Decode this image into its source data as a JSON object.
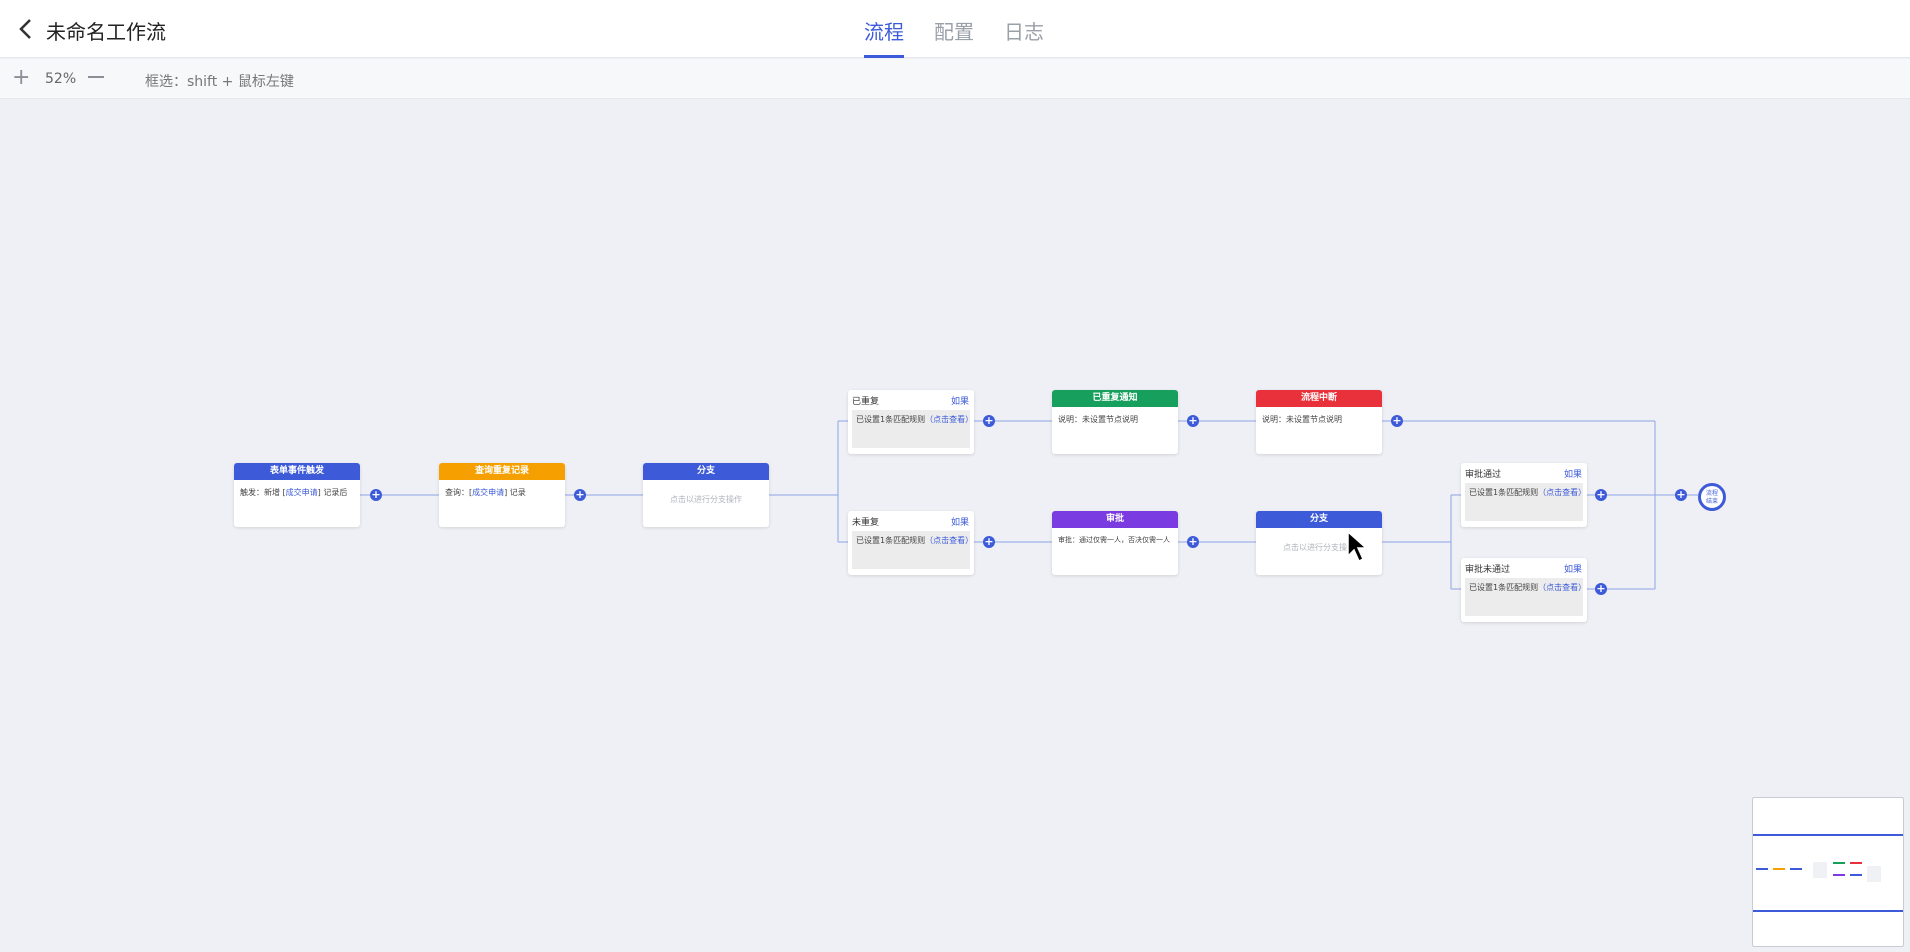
{
  "header": {
    "back_icon": "chevron-left-icon",
    "title": "未命名工作流",
    "tabs": [
      {
        "label": "流程",
        "active": true
      },
      {
        "label": "配置",
        "active": false
      },
      {
        "label": "日志",
        "active": false
      }
    ]
  },
  "toolbar": {
    "zoom_in": "+",
    "zoom_level": "52%",
    "zoom_out_icon": "minus-icon",
    "hint": "框选：shift + 鼠标左键"
  },
  "nodes": {
    "trigger": {
      "title": "表单事件触发",
      "body_prefix": "触发：新增 [",
      "body_link": "成交申请",
      "body_suffix": "] 记录后",
      "color": "#3d5bd9"
    },
    "query": {
      "title": "查询重复记录",
      "body_prefix": "查询：[",
      "body_link": "成交申请",
      "body_suffix": "] 记录",
      "color": "#f5a000"
    },
    "branch1": {
      "title": "分支",
      "body": "点击以进行分支操作",
      "color": "#3d5bd9"
    },
    "notify": {
      "title": "已重复通知",
      "body": "说明：未设置节点说明",
      "color": "#17a05d"
    },
    "stop": {
      "title": "流程中断",
      "body": "说明：未设置节点说明",
      "color": "#e8313a"
    },
    "approve": {
      "title": "审批",
      "body": "审批：通过仅需一人，否决仅需一人",
      "color": "#7a3be0"
    },
    "branch2": {
      "title": "分支",
      "body": "点击以进行分支操作",
      "color": "#3d5bd9"
    }
  },
  "conditions": {
    "repeated": {
      "title": "已重复",
      "action": "如果",
      "rule": "已设置1条匹配规则",
      "link": "（点击查看）"
    },
    "not_repeated": {
      "title": "未重复",
      "action": "如果",
      "rule": "已设置1条匹配规则",
      "link": "（点击查看）"
    },
    "passed": {
      "title": "审批通过",
      "action": "如果",
      "rule": "已设置1条匹配规则",
      "link": "（点击查看）"
    },
    "rejected": {
      "title": "审批未通过",
      "action": "如果",
      "rule": "已设置1条匹配规则",
      "link": "（点击查看）"
    }
  },
  "end_node": {
    "line1": "流程",
    "line2": "结束"
  },
  "add_node_icon": "plus-icon",
  "accent_color": "#3d5bd9"
}
